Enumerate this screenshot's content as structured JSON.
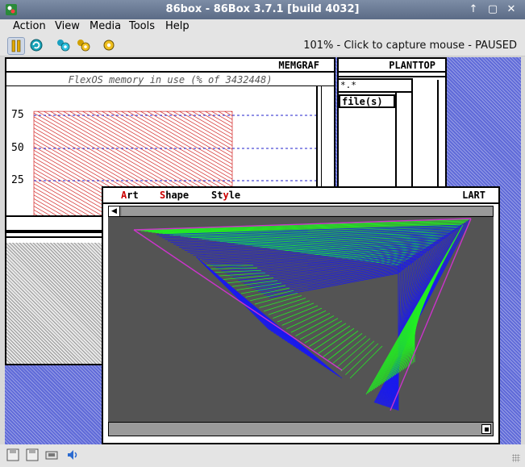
{
  "window": {
    "title": "86box - 86Box 3.7.1 [build 4032]",
    "controls": [
      "↑",
      "▢",
      "✕"
    ]
  },
  "menu": [
    "Action",
    "View",
    "Media",
    "Tools",
    "Help"
  ],
  "toolbar": {
    "status": "101% - Click to capture mouse - PAUSED",
    "buttons": [
      "pause-icon",
      "reset-icon",
      "ctrl-alt-del-icon",
      "ctrl-alt-esc-icon",
      "settings-icon"
    ]
  },
  "emu": {
    "memgraf": {
      "title": "MEMGRAF",
      "caption": "FlexOS memory in use (% of 3432448)",
      "ticks": [
        "75",
        "50",
        "25"
      ],
      "usage_percent": 78
    },
    "planttop": {
      "title": "PLANTTOP",
      "subwindow_title": "*.*",
      "field": "file(s)"
    },
    "lart": {
      "title": "LART",
      "menu": [
        {
          "hot": "A",
          "rest": "rt"
        },
        {
          "hot": "S",
          "rest": "hape"
        },
        {
          "pre": "St",
          "hot": "y",
          "rest": "le"
        }
      ]
    }
  },
  "statusbar": {
    "icons": [
      "floppy-a-icon",
      "floppy-b-icon",
      "network-icon",
      "sound-icon"
    ]
  },
  "colors": {
    "desktop": "#5f6ad8",
    "canvas": "#545454",
    "accent_red": "#cc0000",
    "line_green": "#22ee22",
    "line_blue": "#1a1aee",
    "line_magenta": "#cc33cc"
  }
}
